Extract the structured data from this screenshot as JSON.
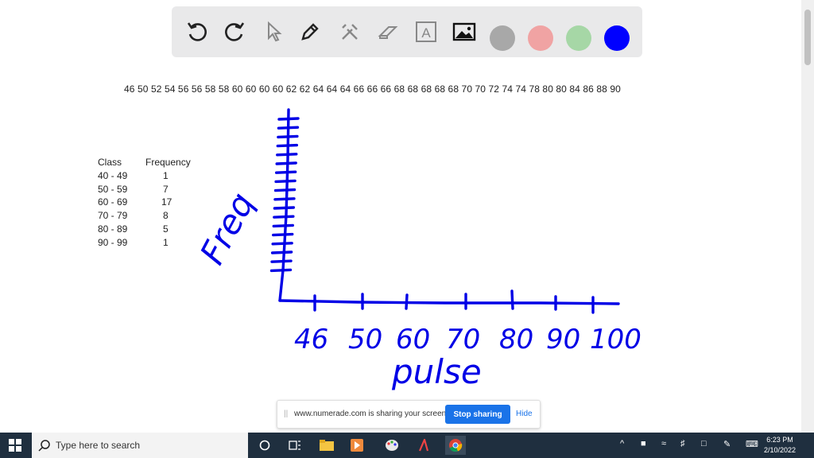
{
  "toolbar": {
    "tools": [
      "undo-icon",
      "redo-icon",
      "pointer-icon",
      "pen-icon",
      "tools-icon",
      "eraser-icon",
      "text-icon",
      "image-icon"
    ],
    "swatches": [
      "#a8a8a8",
      "#f0a3a3",
      "#a6d7a6",
      "#0000ff"
    ],
    "text_tool_label": "A"
  },
  "data_line": "46 50 52 54 56 56 58 58 60 60 60 60 62 62 64 64 64 66 66 66 68 68 68 68 68 70 70 72 74 74 78 80 80 84 86 88 90",
  "table": {
    "header_class": "Class",
    "header_frequency": "Frequency",
    "rows": [
      {
        "class": "40 - 49",
        "frequency": "1"
      },
      {
        "class": "50 - 59",
        "frequency": "7"
      },
      {
        "class": "60 - 69",
        "frequency": "17"
      },
      {
        "class": "70 - 79",
        "frequency": "8"
      },
      {
        "class": "80 - 89",
        "frequency": "5"
      },
      {
        "class": "90 - 99",
        "frequency": "1"
      }
    ]
  },
  "handwriting": {
    "y_label": "Freq",
    "x_label": "pulse",
    "x_ticks": [
      "46",
      "50",
      "60",
      "70",
      "80",
      "90",
      "100"
    ],
    "ink_color": "#0000e6"
  },
  "share_banner": {
    "message": "www.numerade.com is sharing your screen.",
    "stop_label": "Stop sharing",
    "hide_label": "Hide"
  },
  "taskbar": {
    "search_placeholder": "Type here to search",
    "time": "6:23 PM",
    "date": "2/10/2022"
  }
}
